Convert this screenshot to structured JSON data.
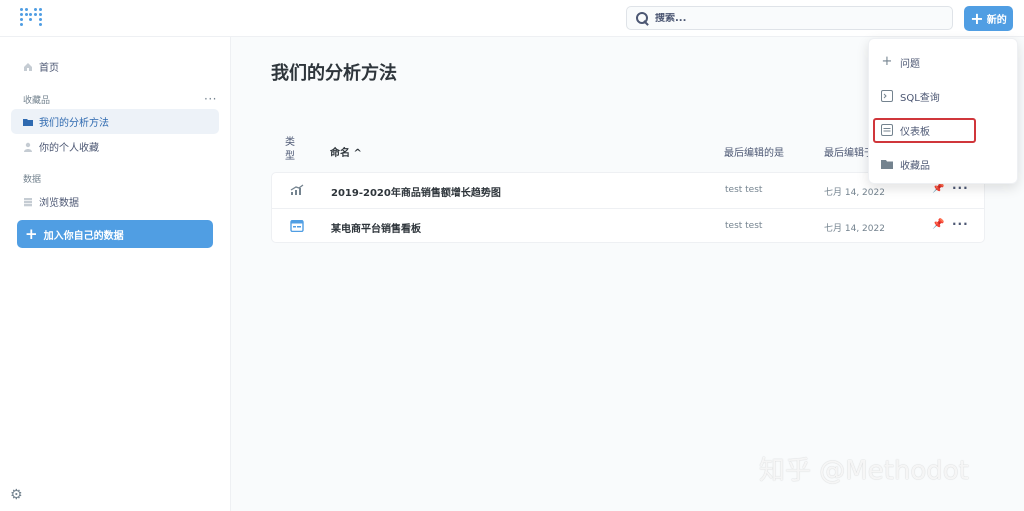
{
  "search": {
    "placeholder": "搜索..."
  },
  "header": {
    "new_label": "新的"
  },
  "sidebar": {
    "home_label": "首页",
    "collections_section": "收藏品",
    "items": [
      {
        "label": "我们的分析方法",
        "icon": "folder-icon",
        "active": true
      },
      {
        "label": "你的个人收藏",
        "icon": "person-icon",
        "active": false
      }
    ],
    "data_section": "数据",
    "browse_label": "浏览数据",
    "add_data_label": "加入你自己的数据"
  },
  "main": {
    "title": "我们的分析方法",
    "columns": {
      "type": "类\n型",
      "name": "命名 ^",
      "last_edited_by": "最后编辑的是",
      "last_edited_at": "最后编辑于"
    },
    "rows": [
      {
        "name": "2019-2020年商品销售额增长趋势图",
        "editor": "test test",
        "date": "七月 14, 2022",
        "icon": "line-chart-icon"
      },
      {
        "name": "某电商平台销售看板",
        "editor": "test test",
        "date": "七月 14, 2022",
        "icon": "dashboard-icon"
      }
    ]
  },
  "menu": {
    "items": [
      {
        "label": "问题",
        "icon": "plus-icon"
      },
      {
        "label": "SQL查询",
        "icon": "sql-icon"
      },
      {
        "label": "仪表板",
        "icon": "dashboard-icon"
      },
      {
        "label": "收藏品",
        "icon": "folder-icon"
      }
    ]
  },
  "watermark": "知乎 @Methodot",
  "colors": {
    "brand": "#509ee3",
    "highlight": "#d0363b"
  }
}
